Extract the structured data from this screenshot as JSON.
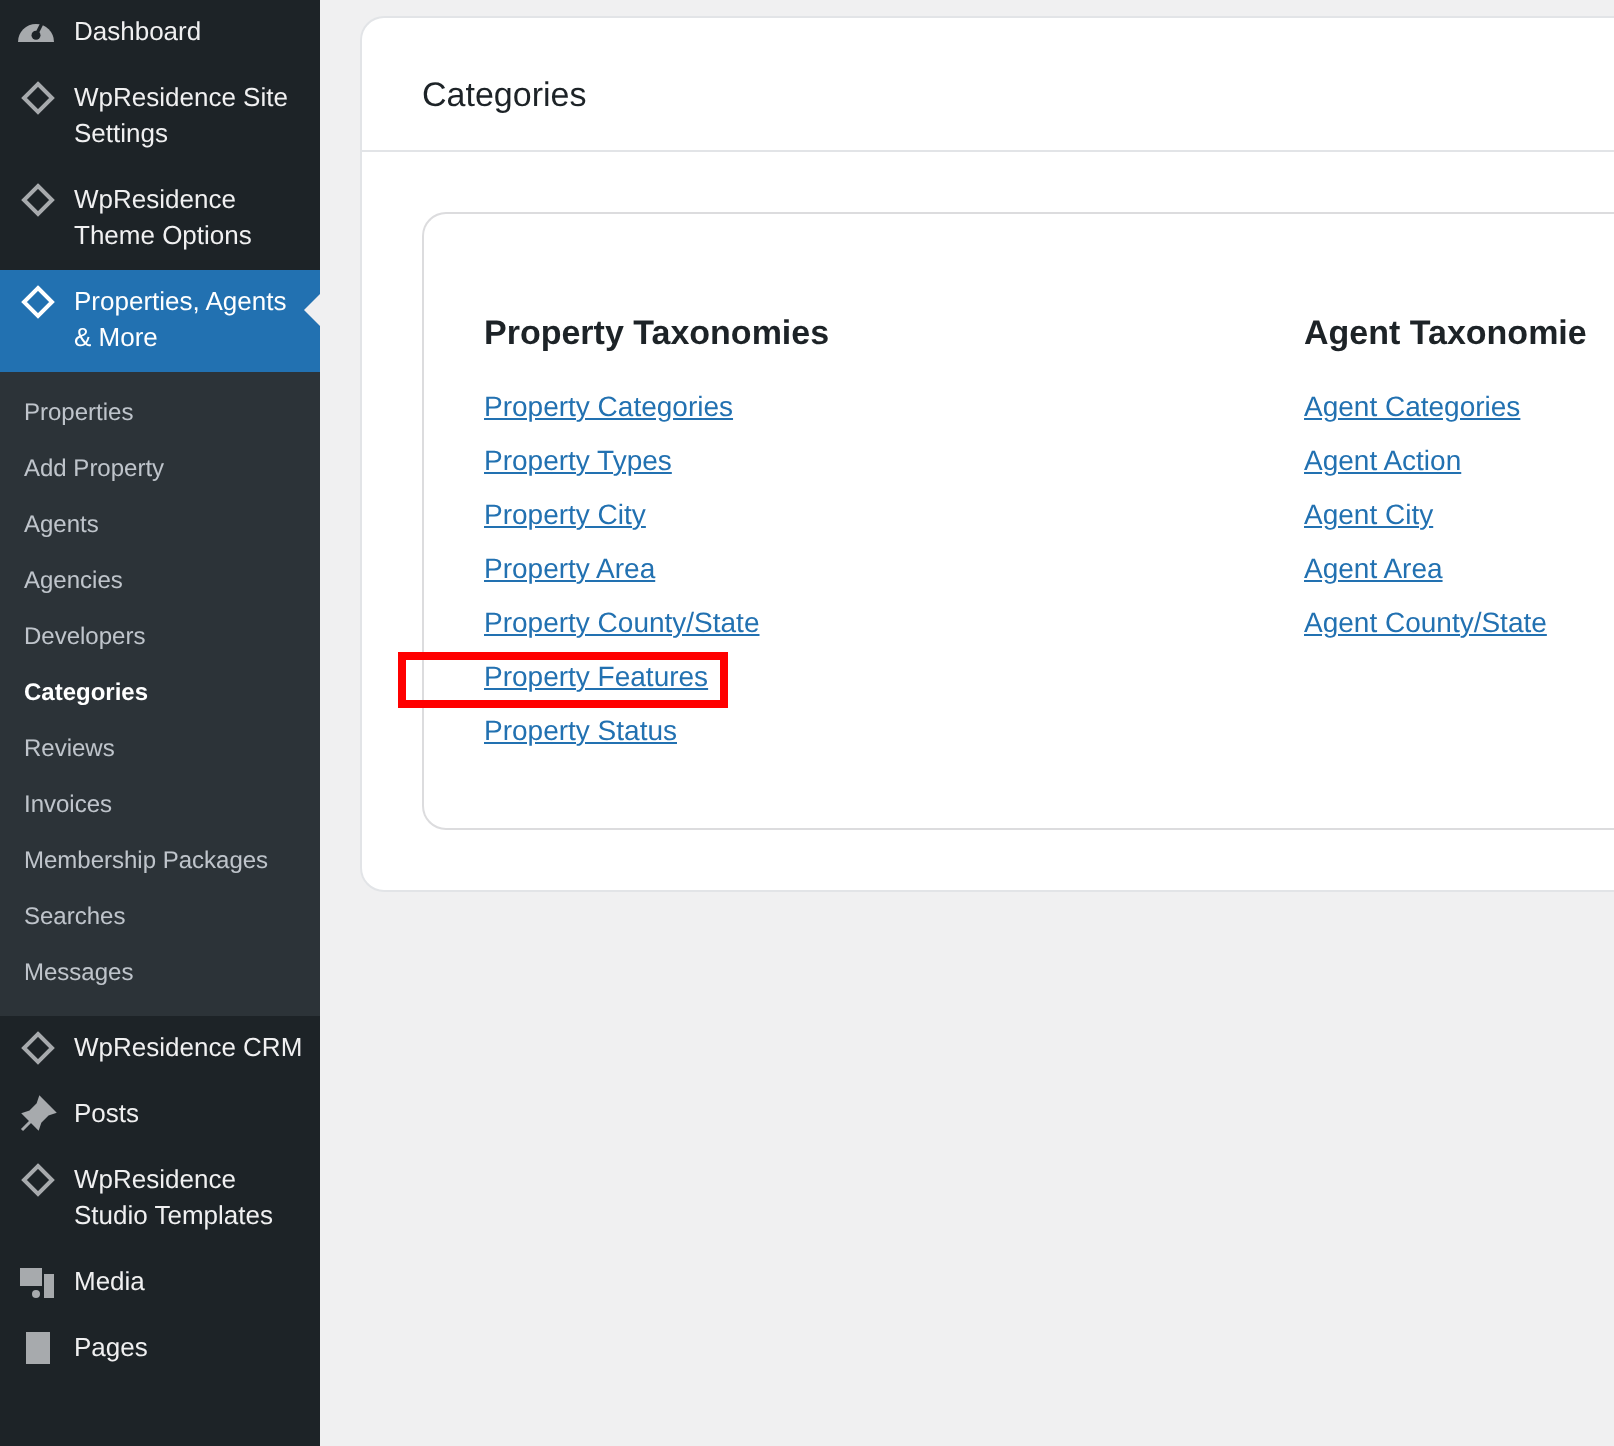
{
  "sidebar": {
    "items": [
      {
        "label": "Dashboard",
        "kind": "gauge",
        "selected": false
      },
      {
        "label": "WpResidence Site Settings",
        "kind": "diamond",
        "selected": false
      },
      {
        "label": "WpResidence Theme Options",
        "kind": "diamond",
        "selected": false
      },
      {
        "label": "Properties, Agents & More",
        "kind": "diamond",
        "selected": true,
        "submenu": [
          {
            "label": "Properties",
            "selected": false
          },
          {
            "label": "Add Property",
            "selected": false
          },
          {
            "label": "Agents",
            "selected": false
          },
          {
            "label": "Agencies",
            "selected": false
          },
          {
            "label": "Developers",
            "selected": false
          },
          {
            "label": "Categories",
            "selected": true
          },
          {
            "label": "Reviews",
            "selected": false
          },
          {
            "label": "Invoices",
            "selected": false
          },
          {
            "label": "Membership Packages",
            "selected": false
          },
          {
            "label": "Searches",
            "selected": false
          },
          {
            "label": "Messages",
            "selected": false
          }
        ]
      },
      {
        "label": "WpResidence CRM",
        "kind": "diamond",
        "selected": false
      },
      {
        "label": "Posts",
        "kind": "pin",
        "selected": false
      },
      {
        "label": "WpResidence Studio Templates",
        "kind": "diamond",
        "selected": false
      },
      {
        "label": "Media",
        "kind": "media",
        "selected": false
      },
      {
        "label": "Pages",
        "kind": "page",
        "selected": false
      }
    ]
  },
  "panel": {
    "title": "Categories",
    "columns": [
      {
        "heading": "Property Taxonomies",
        "links": [
          {
            "label": "Property Categories",
            "highlighted": false
          },
          {
            "label": "Property Types",
            "highlighted": false
          },
          {
            "label": "Property City",
            "highlighted": false
          },
          {
            "label": "Property Area",
            "highlighted": false
          },
          {
            "label": "Property County/State",
            "highlighted": false
          },
          {
            "label": "Property Features",
            "highlighted": true
          },
          {
            "label": "Property Status",
            "highlighted": false
          }
        ]
      },
      {
        "heading": "Agent Taxonomie",
        "links": [
          {
            "label": "Agent Categories",
            "highlighted": false
          },
          {
            "label": "Agent Action",
            "highlighted": false
          },
          {
            "label": "Agent City",
            "highlighted": false
          },
          {
            "label": "Agent Area",
            "highlighted": false
          },
          {
            "label": "Agent County/State",
            "highlighted": false
          }
        ]
      }
    ]
  }
}
